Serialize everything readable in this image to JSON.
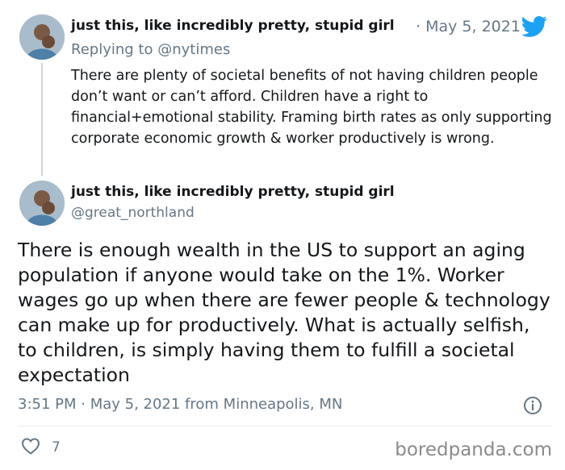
{
  "reply_tweet": {
    "display_name": "just this, like incredibly pretty, stupid girl",
    "separator": "·",
    "date": "May 5, 2021",
    "replying_prefix": "Replying to",
    "replying_handle": "@nytimes",
    "text": "There are plenty of societal benefits of not having children people don’t want or can’t afford. Children have a right to financial+emotional stability. Framing birth rates as only supporting corporate economic growth & worker productively is wrong."
  },
  "main_tweet": {
    "display_name": "just this, like incredibly pretty, stupid girl",
    "handle": "@great_northland",
    "text": "There is enough wealth in the US to support an aging population if anyone would take on the 1%. Worker wages go up when there are fewer people & technology can make up for productively. What is actually selfish, to children, is simply having them to fulfill a societal expectation",
    "timestamp": "3:51 PM · May 5, 2021 from Minneapolis, MN",
    "like_count": "7"
  },
  "watermark": "boredpanda.com",
  "colors": {
    "twitter_blue": "#1da1f2",
    "muted": "#657786",
    "text": "#14171a"
  },
  "icons": [
    "twitter-bird-icon",
    "info-icon",
    "heart-icon"
  ]
}
